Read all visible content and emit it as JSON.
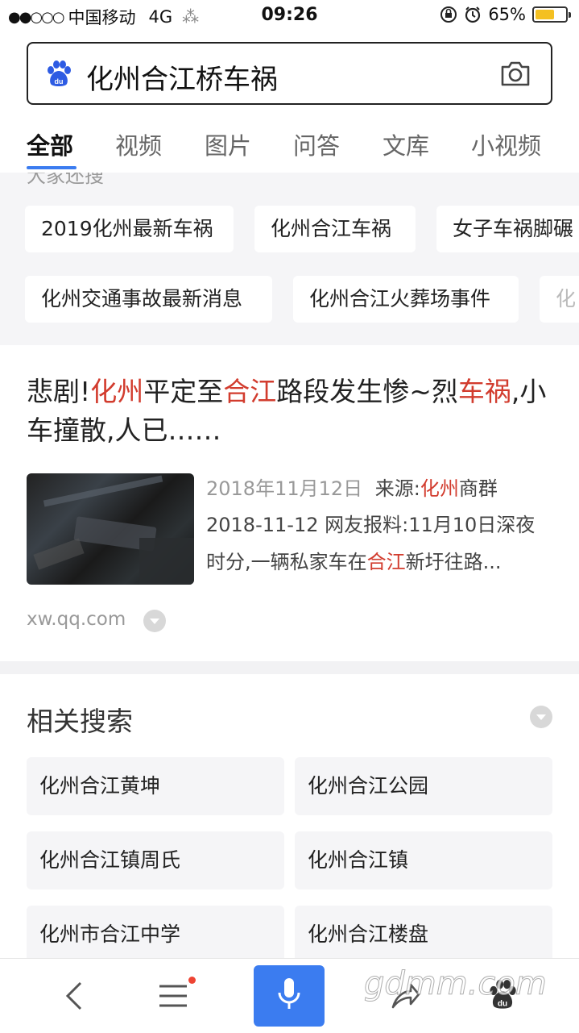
{
  "status": {
    "carrier": "中国移动",
    "network": "4G",
    "time": "09:26",
    "battery": "65%",
    "battery_fraction": 0.65
  },
  "search": {
    "query": "化州合江桥车祸"
  },
  "tabs": [
    {
      "label": "全部"
    },
    {
      "label": "视频"
    },
    {
      "label": "图片"
    },
    {
      "label": "问答"
    },
    {
      "label": "文库"
    },
    {
      "label": "小视频"
    }
  ],
  "people_also": {
    "label": "大家还搜",
    "row1": [
      "2019化州最新车祸",
      "化州合江车祸",
      "女子车祸脚碾"
    ],
    "row2": [
      "化州交通事故最新消息",
      "化州合江火葬场事件",
      "化"
    ]
  },
  "result": {
    "title_parts": [
      {
        "text": "悲剧!",
        "hl": false
      },
      {
        "text": "化州",
        "hl": true
      },
      {
        "text": "平定至",
        "hl": false
      },
      {
        "text": "合江",
        "hl": true
      },
      {
        "text": "路段发生惨~烈",
        "hl": false
      },
      {
        "text": "车祸",
        "hl": true
      },
      {
        "text": ",小车撞散,人已……",
        "hl": false
      }
    ],
    "date": "2018年11月12日",
    "source_label": "来源:",
    "source_hl": "化州",
    "source_rest": "商群",
    "snippet_line1": "2018-11-12 网友报料:11月10日深夜",
    "snippet_line2_a": "时分,一辆私家车在",
    "snippet_line2_hl": "合江",
    "snippet_line2_b": "新圩往路...",
    "site": "xw.qq.com"
  },
  "related": {
    "title": "相关搜索",
    "items": [
      "化州合江黄坤",
      "化州合江公园",
      "化州合江镇周氏",
      "化州合江镇",
      "化州市合江中学",
      "化州合江楼盘"
    ]
  },
  "watermark": "gdmm.com",
  "colors": {
    "accent": "#3b7cf0",
    "highlight": "#d23c2e",
    "battery": "#f4c021"
  }
}
